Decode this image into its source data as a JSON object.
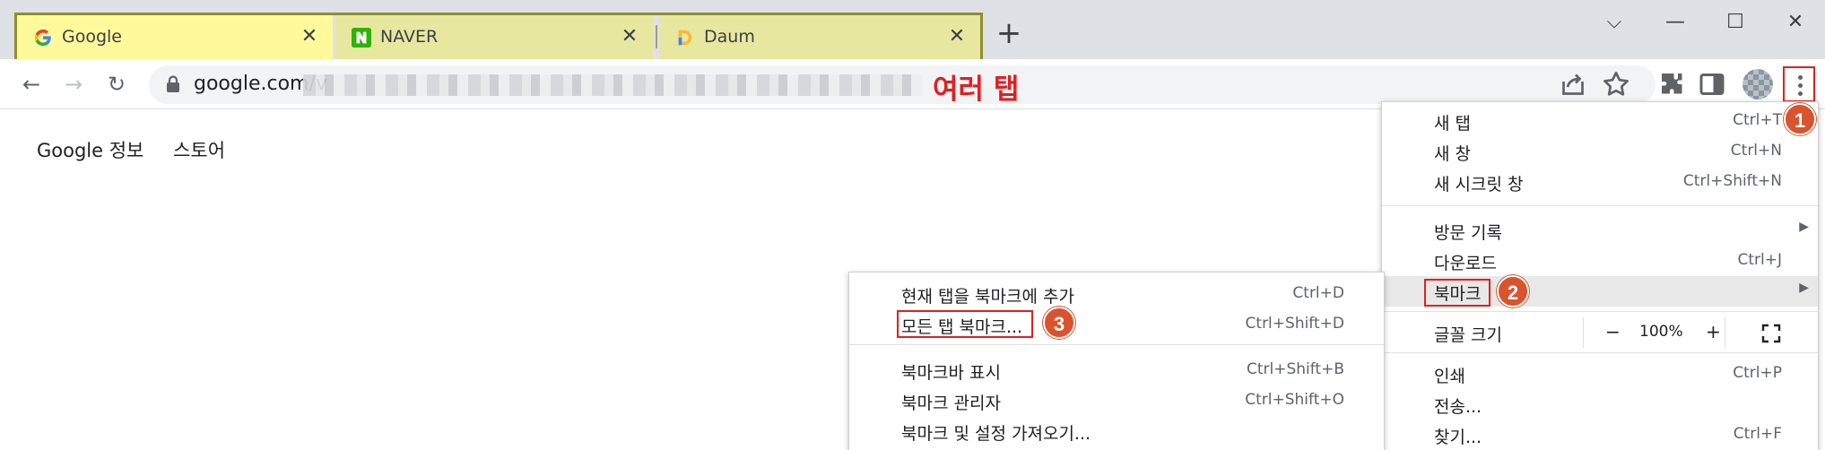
{
  "tabs": [
    {
      "title": "Google",
      "favicon": "google-favicon",
      "active": true
    },
    {
      "title": "NAVER",
      "favicon": "naver-favicon",
      "active": false
    },
    {
      "title": "Daum",
      "favicon": "daum-favicon",
      "active": false
    }
  ],
  "tab_close_glyph": "✕",
  "new_tab_glyph": "+",
  "window_controls": {
    "collapse": "⌵",
    "minimize": "—",
    "maximize": "☐",
    "close": "✕"
  },
  "toolbar": {
    "back_glyph": "←",
    "forward_glyph": "→",
    "reload_glyph": "↻",
    "url": "google.com/v"
  },
  "annotation_multiple_tabs": "여러 탭",
  "page_links": [
    "Google 정보",
    "스토어"
  ],
  "main_menu": {
    "items": [
      {
        "label": "새 탭",
        "shortcut": "Ctrl+T"
      },
      {
        "label": "새 창",
        "shortcut": "Ctrl+N"
      },
      {
        "label": "새 시크릿 창",
        "shortcut": "Ctrl+Shift+N"
      },
      {
        "label": "방문 기록",
        "shortcut": ""
      },
      {
        "label": "다운로드",
        "shortcut": "Ctrl+J"
      },
      {
        "label": "북마크",
        "shortcut": ""
      },
      {
        "label": "글꼴 크기",
        "shortcut": ""
      },
      {
        "label": "인쇄",
        "shortcut": "Ctrl+P"
      },
      {
        "label": "전송...",
        "shortcut": ""
      },
      {
        "label": "찾기...",
        "shortcut": "Ctrl+F"
      }
    ],
    "submenu_arrow": "▶",
    "zoom": {
      "minus": "−",
      "value": "100%",
      "plus": "+",
      "fullscreen_icon": "fullscreen-icon"
    }
  },
  "bookmark_submenu": {
    "items": [
      {
        "label": "현재 탭을 북마크에 추가",
        "shortcut": "Ctrl+D"
      },
      {
        "label": "모든 탭 북마크...",
        "shortcut": "Ctrl+Shift+D"
      },
      {
        "label": "북마크바 표시",
        "shortcut": "Ctrl+Shift+B"
      },
      {
        "label": "북마크 관리자",
        "shortcut": "Ctrl+Shift+O"
      },
      {
        "label": "북마크 및 설정 가져오기...",
        "shortcut": ""
      }
    ]
  },
  "step_badges": [
    "1",
    "2",
    "3"
  ],
  "colors": {
    "tab_active": "#fef99a",
    "tab_inactive": "#e8e7a0",
    "annotation_red": "#e02020",
    "badge": "#d9532e"
  }
}
